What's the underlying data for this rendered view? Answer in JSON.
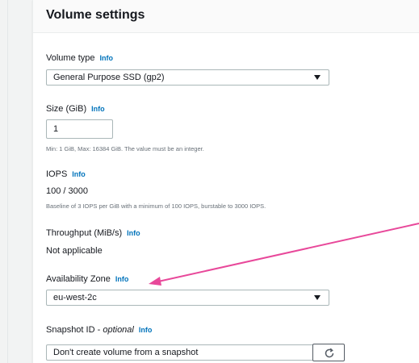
{
  "section": {
    "title": "Volume settings",
    "info_label": "Info"
  },
  "volume_type": {
    "label": "Volume type",
    "selected": "General Purpose SSD (gp2)"
  },
  "size": {
    "label": "Size (GiB)",
    "value": "1",
    "hint": "Min: 1 GiB, Max: 16384 GiB. The value must be an integer."
  },
  "iops": {
    "label": "IOPS",
    "value": "100 / 3000",
    "hint": "Baseline of 3 IOPS per GiB with a minimum of 100 IOPS, burstable to 3000 IOPS."
  },
  "throughput": {
    "label": "Throughput (MiB/s)",
    "value": "Not applicable"
  },
  "availability_zone": {
    "label": "Availability Zone",
    "selected": "eu-west-2c"
  },
  "snapshot": {
    "label": "Snapshot ID - ",
    "label_optional": "optional",
    "selected": "Don't create volume from a snapshot"
  },
  "colors": {
    "accent_link": "#0073bb",
    "annotation_arrow": "#e8489a",
    "border": "#aab7b8"
  },
  "icons": {
    "dropdown": "caret-down-icon",
    "refresh": "refresh-icon"
  }
}
